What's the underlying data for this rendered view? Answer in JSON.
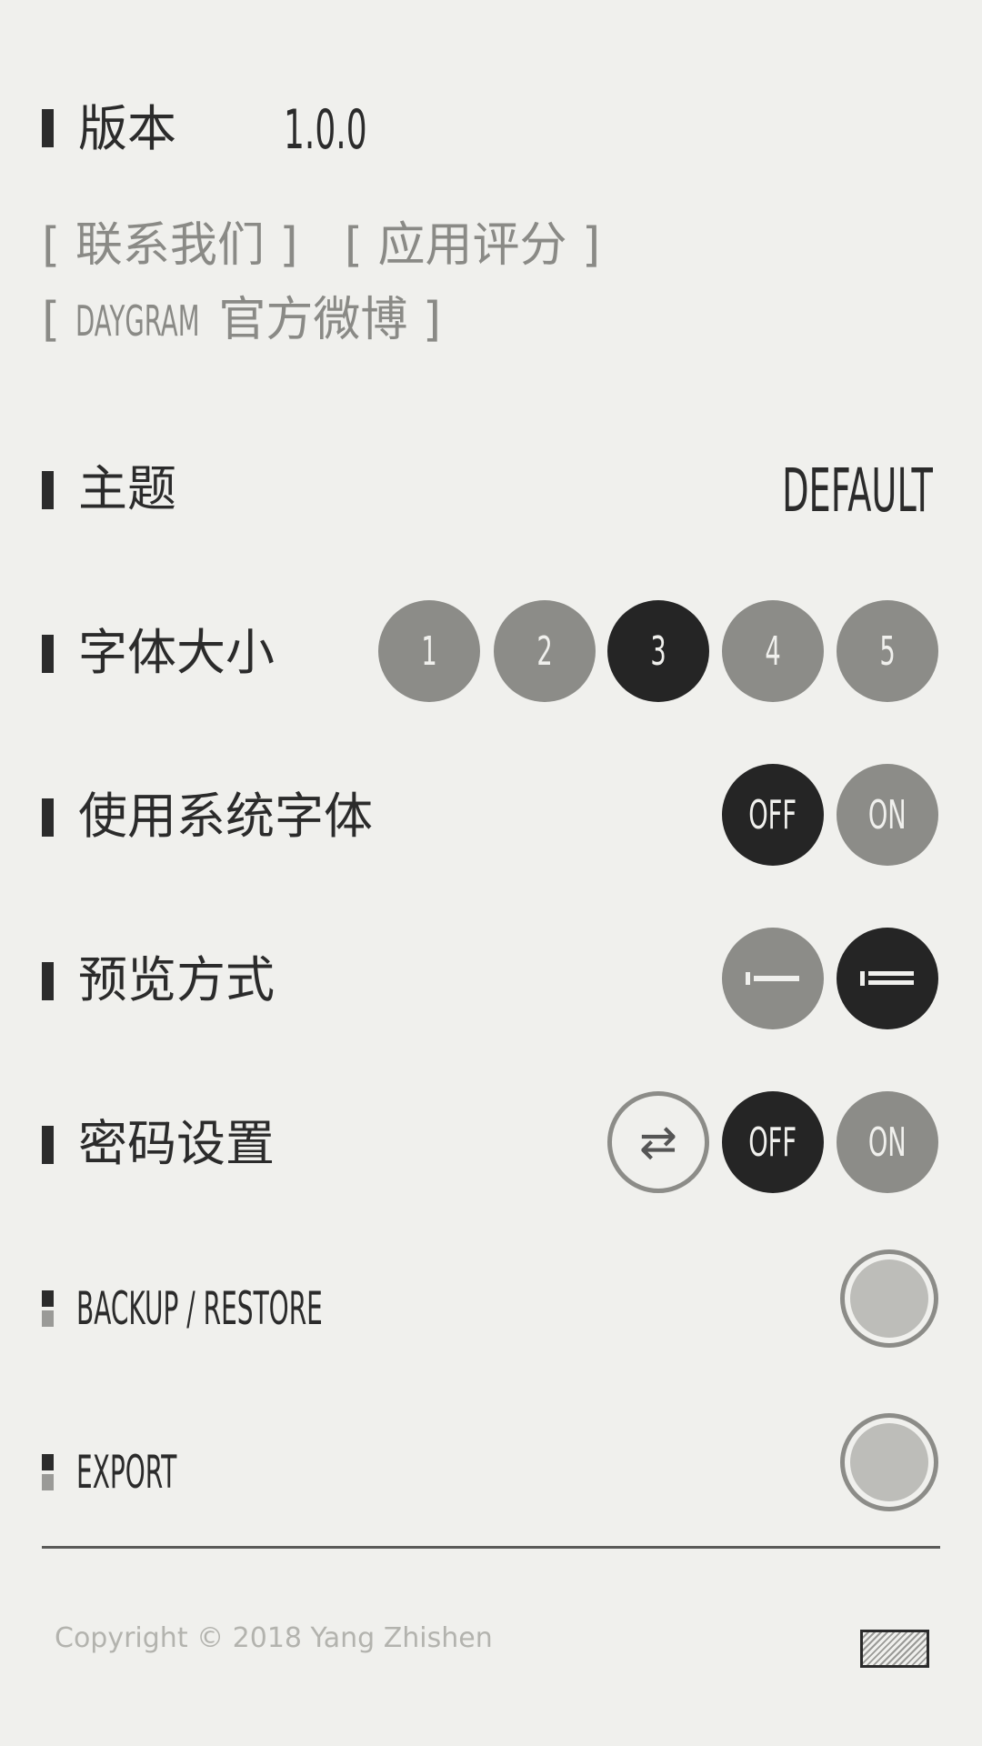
{
  "version": {
    "label": "版本",
    "value": "1.0.0"
  },
  "links": {
    "contact": "[ 联系我们 ]",
    "rate": "[ 应用评分 ]",
    "weibo_prefix": "[ ",
    "weibo_brand": "DAYGRAM",
    "weibo_suffix": "官方微博 ]"
  },
  "theme": {
    "label": "主题",
    "value": "DEFAULT"
  },
  "font_size": {
    "label": "字体大小",
    "options": [
      "1",
      "2",
      "3",
      "4",
      "5"
    ],
    "selected": "3"
  },
  "system_font": {
    "label": "使用系统字体",
    "off_label": "OFF",
    "on_label": "ON",
    "selected": "OFF"
  },
  "preview_mode": {
    "label": "预览方式",
    "options": [
      "single-line-icon",
      "double-line-icon"
    ],
    "selected": "double-line-icon"
  },
  "password": {
    "label": "密码设置",
    "swap_icon": "swap-arrows-icon",
    "swap_glyph": "⇄",
    "off_label": "OFF",
    "on_label": "ON",
    "selected": "OFF"
  },
  "backup": {
    "label": "BACKUP / RESTORE"
  },
  "export": {
    "label": "EXPORT"
  },
  "footer": {
    "copyright": "Copyright © 2018 Yang Zhishen",
    "icon": "hatched-box-icon"
  },
  "colors": {
    "background": "#f0f0ed",
    "dark": "#252525",
    "mid_gray": "#8c8c88",
    "light_gray": "#bdbdb9",
    "text_muted": "#8a8a86"
  }
}
